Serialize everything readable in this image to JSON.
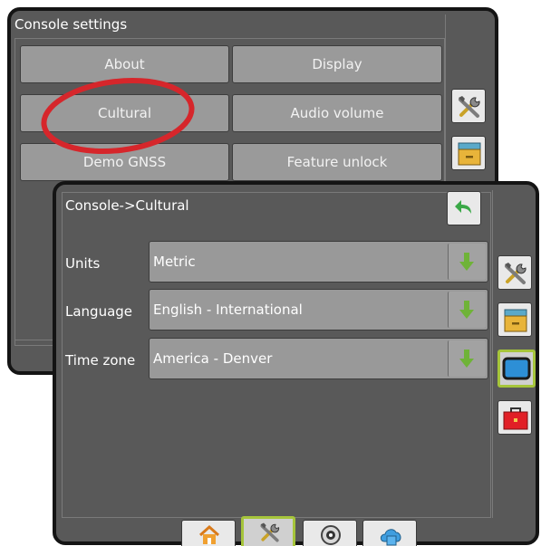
{
  "console_settings": {
    "title": "Console settings",
    "buttons": [
      {
        "label": "About"
      },
      {
        "label": "Display"
      },
      {
        "label": "Cultural"
      },
      {
        "label": "Audio volume"
      },
      {
        "label": "Demo GNSS"
      },
      {
        "label": "Feature unlock"
      }
    ],
    "side_tabs": [
      {
        "icon": "tools-icon"
      },
      {
        "icon": "data-drawer-icon"
      }
    ]
  },
  "cultural": {
    "title": "Console->Cultural",
    "fields": [
      {
        "label": "Units",
        "value": "Metric"
      },
      {
        "label": "Language",
        "value": "English - International"
      },
      {
        "label": "Time zone",
        "value": "America - Denver"
      }
    ],
    "side_tabs": [
      {
        "icon": "tools-icon"
      },
      {
        "icon": "data-drawer-icon"
      },
      {
        "icon": "display-screen-icon",
        "selected": true
      },
      {
        "icon": "toolbox-icon"
      }
    ],
    "bottom_nav": [
      {
        "icon": "home-icon"
      },
      {
        "icon": "tools-icon",
        "selected": true
      },
      {
        "icon": "guidance-target-icon"
      },
      {
        "icon": "cloud-sync-icon"
      }
    ]
  },
  "annotation": {
    "circled_item": "Cultural",
    "color": "#d6262b"
  },
  "colors": {
    "panel": "#595959",
    "button": "#9a9a9a",
    "selected_outline": "#a6c53b",
    "arrow_green": "#6fb338",
    "back_arrow_green": "#3aa847"
  }
}
